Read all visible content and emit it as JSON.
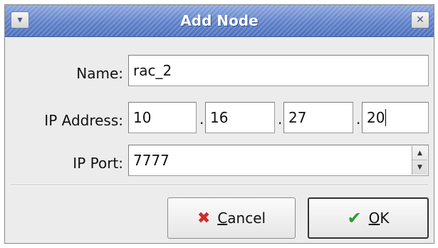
{
  "window": {
    "title": "Add Node",
    "menu_glyph": "▾",
    "close_glyph": "✕"
  },
  "form": {
    "name_label": "Name:",
    "name_value": "rac_2",
    "ip_label": "IP Address:",
    "ip_octets": [
      "10",
      "16",
      "27",
      "20"
    ],
    "ip_dot": ".",
    "port_label": "IP Port:",
    "port_value": "7777"
  },
  "buttons": {
    "cancel_mnemonic": "C",
    "cancel_rest": "ancel",
    "ok_mnemonic": "O",
    "ok_rest": "K"
  },
  "icons": {
    "window_menu": "chevron-down-icon",
    "close": "close-icon",
    "cancel": "x-icon",
    "ok": "check-icon",
    "spin_up": "arrow-up-icon",
    "spin_down": "arrow-down-icon"
  },
  "colors": {
    "titlebar": "#5f81c9",
    "cancel_icon": "#d02b2b",
    "ok_icon": "#2f9a2f"
  }
}
